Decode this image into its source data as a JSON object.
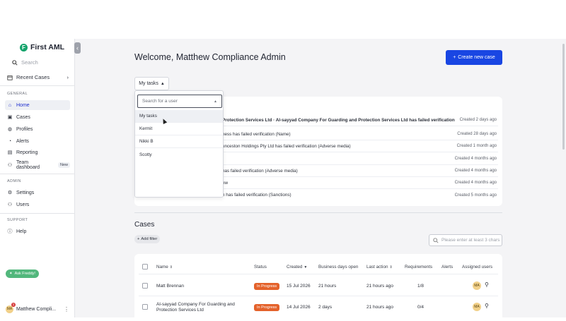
{
  "app": {
    "brand": "First AML",
    "brand_mark": "F"
  },
  "sidebar": {
    "search_placeholder": "Search",
    "recent_cases": "Recent Cases",
    "general_label": "GENERAL",
    "items": [
      {
        "label": "Home",
        "icon": "home-icon"
      },
      {
        "label": "Cases",
        "icon": "cases-icon"
      },
      {
        "label": "Profiles",
        "icon": "profiles-icon"
      },
      {
        "label": "Alerts",
        "icon": "bell-icon"
      },
      {
        "label": "Reporting",
        "icon": "report-icon"
      },
      {
        "label": "Team dashboard",
        "icon": "team-icon",
        "badge": "New"
      }
    ],
    "admin_label": "ADMIN",
    "admin_items": [
      {
        "label": "Settings",
        "icon": "gear-icon"
      },
      {
        "label": "Users",
        "icon": "users-icon"
      }
    ],
    "support_label": "SUPPORT",
    "support_items": [
      {
        "label": "Help",
        "icon": "help-icon"
      }
    ],
    "ask_freddy": "Ask Freddy!",
    "user": {
      "initials": "MA",
      "name": "Matthew Compli...",
      "notifications": "1"
    }
  },
  "header": {
    "welcome": "Welcome, Matthew Compliance Admin",
    "create_button": "Create new case",
    "tasks_filter": "My tasks"
  },
  "tasks": [
    {
      "text": "Protection Services Ltd · Al-sayyad Company For Guarding and Protection Services Ltd has failed verification",
      "date": "Created 2 days ago"
    },
    {
      "text": "ness has failed verification (Name)",
      "date": "Created 28 days ago"
    },
    {
      "text": "unceston Holdings Pty Ltd has failed verification (Adverse media)",
      "date": "Created 1 month ago"
    },
    {
      "text": "",
      "date": "Created 4 months ago"
    },
    {
      "text": "has failed verification (Adverse media)",
      "date": "Created 4 months ago"
    },
    {
      "text": "ew",
      "date": "Created 4 months ago"
    },
    {
      "text": "h has failed verification (Sanctions)",
      "date": "Created 5 months ago"
    }
  ],
  "dropdown": {
    "placeholder": "Search for a user",
    "options": [
      "My tasks",
      "Kermit",
      "Nikki B",
      "Scotty"
    ]
  },
  "cases": {
    "heading": "Cases",
    "add_filter": "Add filter",
    "search_placeholder": "Please enter at least 3 chars",
    "columns": [
      "Name",
      "Status",
      "Created",
      "Business days open",
      "Last action",
      "Requirements",
      "Alerts",
      "Assigned users"
    ],
    "rows": [
      {
        "name": "Matt Brennan",
        "name2": "",
        "status": "In Progress",
        "created": "15 Jul 2026",
        "days_open": "21 hours",
        "last_action": "21 hours ago",
        "requirements": "1/8",
        "assigned": "MA"
      },
      {
        "name": "Al-sayyad Company For Guarding and",
        "name2": "Protection Services Ltd",
        "status": "In Progress",
        "created": "14 Jul 2026",
        "days_open": "2 days",
        "last_action": "21 hours ago",
        "requirements": "0/4",
        "assigned": "MA"
      }
    ]
  },
  "colors": {
    "accent": "#1946e3",
    "status_in_progress": "#e4622b",
    "brand_green": "#14a36b",
    "ask_freddy": "#52b77c"
  }
}
